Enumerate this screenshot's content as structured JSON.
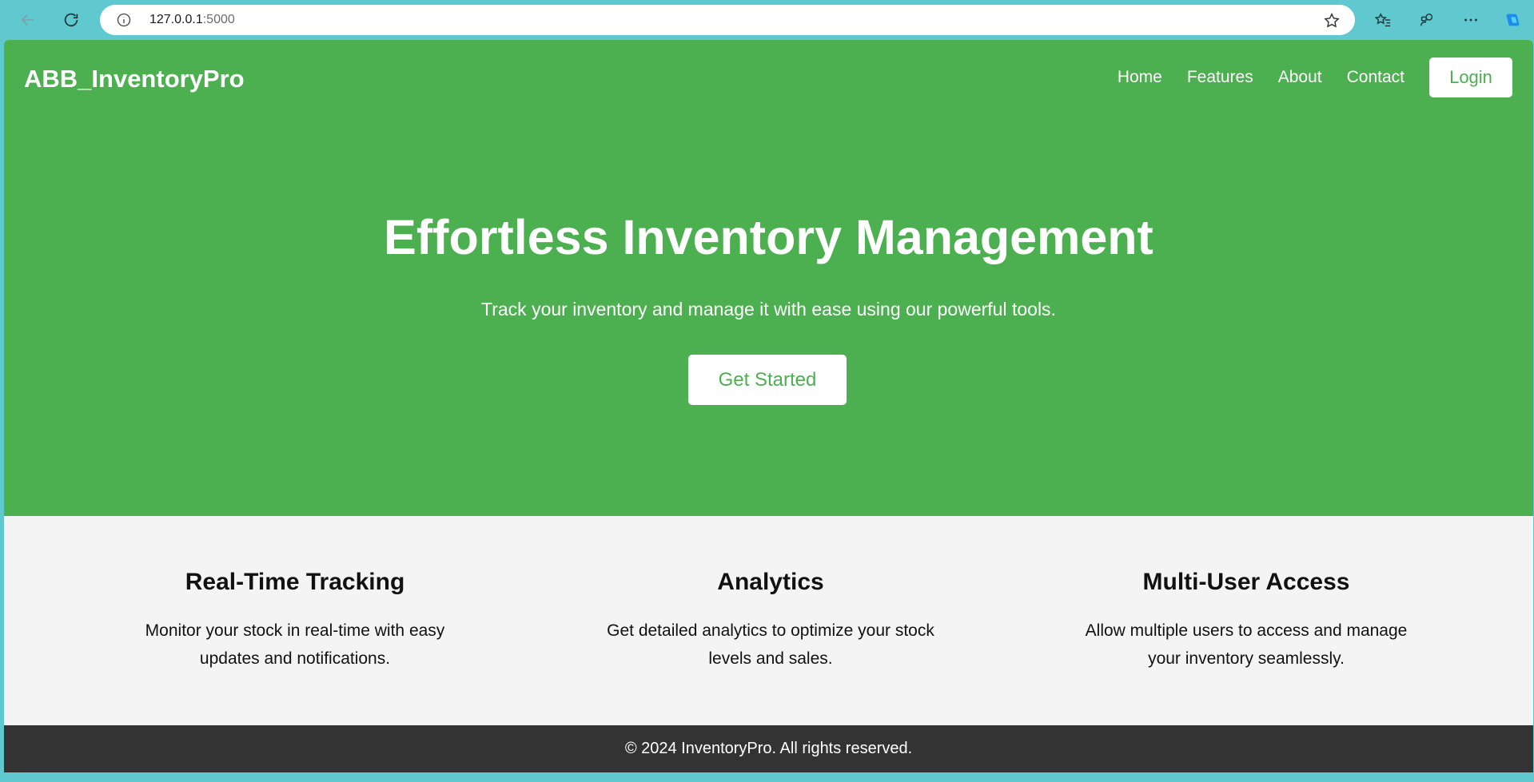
{
  "browser": {
    "url_host": "127.0.0.1",
    "url_port": ":5000",
    "icons": [
      "back-arrow-icon",
      "refresh-icon",
      "info-icon",
      "star-icon",
      "favorites-icon",
      "extensions-icon",
      "more-icon",
      "copilot-icon"
    ]
  },
  "header": {
    "brand": "ABB_InventoryPro",
    "nav": [
      {
        "label": "Home"
      },
      {
        "label": "Features"
      },
      {
        "label": "About"
      },
      {
        "label": "Contact"
      }
    ],
    "login_label": "Login"
  },
  "hero": {
    "title": "Effortless Inventory Management",
    "subtitle": "Track your inventory and manage it with ease using our powerful tools.",
    "cta_label": "Get Started"
  },
  "features": [
    {
      "title": "Real-Time Tracking",
      "text": "Monitor your stock in real-time with easy updates and notifications."
    },
    {
      "title": "Analytics",
      "text": "Get detailed analytics to optimize your stock levels and sales."
    },
    {
      "title": "Multi-User Access",
      "text": "Allow multiple users to access and manage your inventory seamlessly."
    }
  ],
  "footer": {
    "text": "© 2024 InventoryPro. All rights reserved."
  },
  "colors": {
    "primary_green": "#4caf50",
    "footer_bg": "#333333",
    "features_bg": "#f4f4f4",
    "browser_frame": "#5fc9cf"
  }
}
